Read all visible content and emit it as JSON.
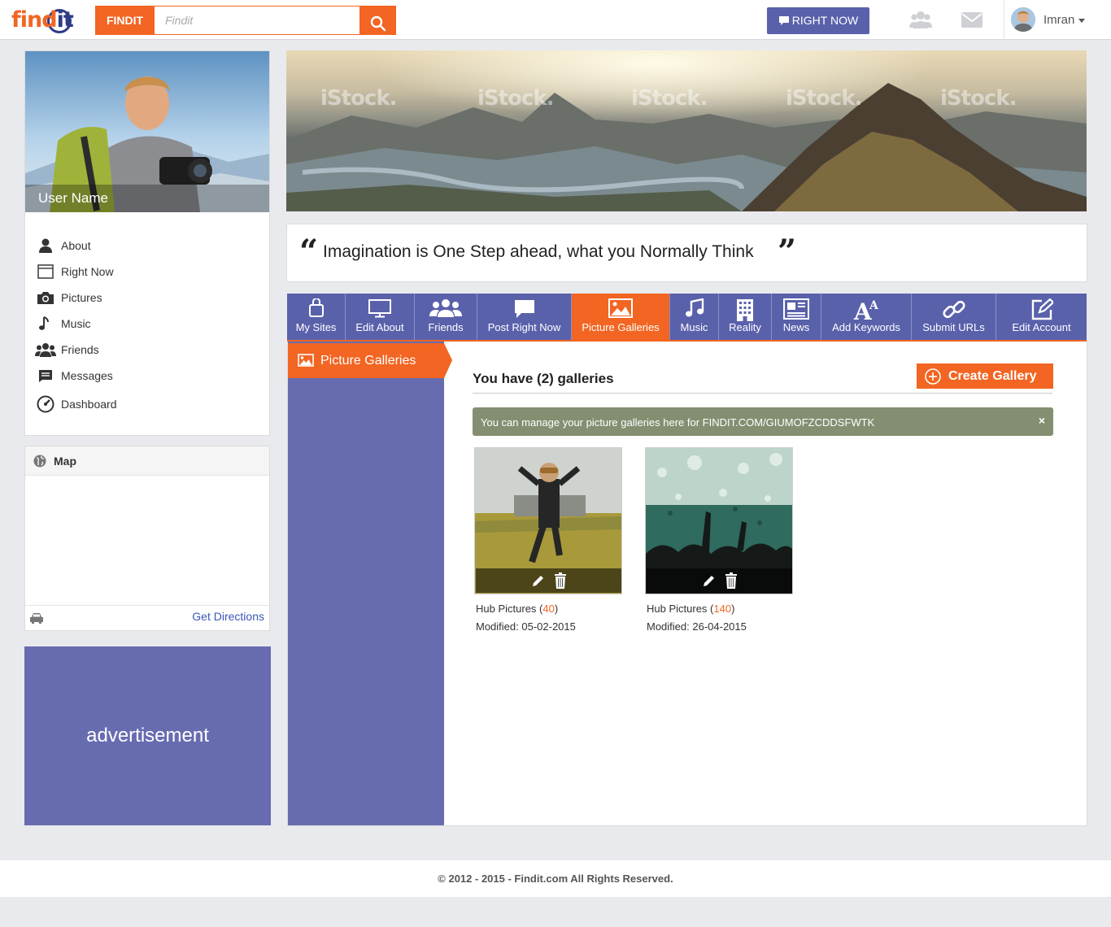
{
  "header": {
    "search_category": "FINDIT",
    "search_placeholder": "Findit",
    "right_now_label": "RIGHT NOW",
    "user_name": "Imran"
  },
  "profile": {
    "name": "User Name"
  },
  "side_menu": [
    {
      "label": "About",
      "icon": "user-icon"
    },
    {
      "label": "Right Now",
      "icon": "window-icon"
    },
    {
      "label": "Pictures",
      "icon": "camera-icon"
    },
    {
      "label": "Music",
      "icon": "music-note-icon"
    },
    {
      "label": "Friends",
      "icon": "group-icon"
    },
    {
      "label": "Messages",
      "icon": "chat-icon"
    },
    {
      "label": "Dashboard",
      "icon": "gauge-icon"
    }
  ],
  "map": {
    "title": "Map",
    "directions_label": "Get Directions"
  },
  "ad": {
    "label": "advertisement"
  },
  "quote": {
    "open_mark": "“",
    "text": "Imagination is One Step ahead, what you Normally Think",
    "close_mark": "”"
  },
  "tabs": [
    {
      "label": "My Sites",
      "icon": "bag-icon"
    },
    {
      "label": "Edit About",
      "icon": "monitor-icon"
    },
    {
      "label": "Friends",
      "icon": "group-icon"
    },
    {
      "label": "Post Right Now",
      "icon": "speech-bubble-icon"
    },
    {
      "label": "Picture Galleries",
      "icon": "image-icon",
      "active": true
    },
    {
      "label": "Music",
      "icon": "music-note-icon"
    },
    {
      "label": "Reality",
      "icon": "building-icon"
    },
    {
      "label": "News",
      "icon": "newspaper-icon"
    },
    {
      "label": "Add Keywords",
      "icon": "font-size-icon"
    },
    {
      "label": "Submit URLs",
      "icon": "link-icon"
    },
    {
      "label": "Edit Account",
      "icon": "edit-icon"
    }
  ],
  "subnav": {
    "active_label": "Picture Galleries"
  },
  "galleries": {
    "title": "You have (2) galleries",
    "create_label": "Create Gallery",
    "alert_text": "You can manage your picture galleries here for FINDIT.COM/GIUMOFZCDDSFWTK",
    "alert_close": "×",
    "items": [
      {
        "name": "Hub Pictures",
        "count": "40",
        "modified": "Modified: 05-02-2015"
      },
      {
        "name": "Hub Pictures",
        "count": "140",
        "modified": "Modified: 26-04-2015"
      }
    ]
  },
  "footer": {
    "copyright": "© 2012 - 2015 - Findit.com All Rights Reserved."
  },
  "colors": {
    "accent": "#f26522",
    "primary": "#5a61ab",
    "alert": "#848f72"
  }
}
